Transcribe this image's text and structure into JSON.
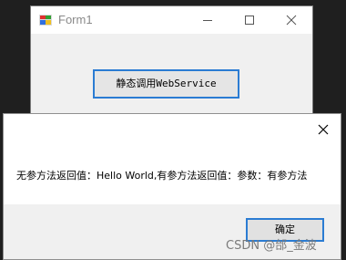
{
  "form1": {
    "title": "Form1",
    "button_label": "静态调用WebService"
  },
  "messagebox": {
    "text": "无参方法返回值：Hello World,有参方法返回值：参数：有参方法",
    "ok_label": "确定"
  },
  "watermark": "CSDN @邰_金波",
  "colors": {
    "accent": "#2b7cd3",
    "window_bg": "#f0f0f0",
    "desktop_bg": "#1f1f1f"
  },
  "icons": [
    "app-icon",
    "minimize-icon",
    "maximize-icon",
    "close-icon"
  ]
}
